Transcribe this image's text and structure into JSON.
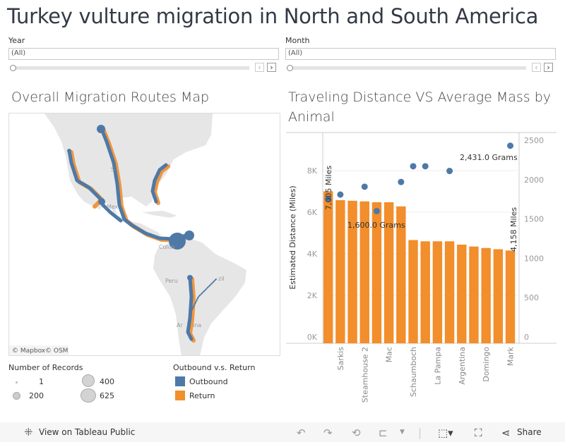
{
  "title": "Turkey vulture migration in North and South America",
  "filters": [
    {
      "label": "Year",
      "value": "(All)"
    },
    {
      "label": "Month",
      "value": "(All)"
    }
  ],
  "map": {
    "title": "Overall Migration Routes Map",
    "attribution": [
      "© Mapbox",
      "© OSM"
    ],
    "place_labels": [
      "S",
      "Mex",
      "Colon",
      "Peru",
      "Ar",
      "ina",
      "zil"
    ],
    "legend_size": {
      "title": "Number of Records",
      "items": [
        "1",
        "200",
        "400",
        "625"
      ]
    },
    "legend_color": {
      "title": "Outbound v.s. Return",
      "items": [
        {
          "label": "Outbound",
          "color": "#4e79a7"
        },
        {
          "label": "Return",
          "color": "#f28e2b"
        }
      ]
    }
  },
  "chart_data": {
    "type": "bar",
    "title": "Traveling Distance VS Average Mass by Animal",
    "ylabel": "Estimated Distance (Miles)",
    "ylim": [
      0,
      9500
    ],
    "y_ticks": [
      "0K",
      "2K",
      "4K",
      "6K",
      "8K"
    ],
    "y2lim": [
      0,
      2600
    ],
    "y2_ticks": [
      "0",
      "500",
      "1000",
      "1500",
      "2000",
      "2500"
    ],
    "categories": [
      "",
      "Sarkis",
      "",
      "Steamhouse 2",
      "",
      "Mac",
      "",
      "Schaumboch",
      "",
      "La Pampa",
      "",
      "Argentina",
      "",
      "Domingo",
      "",
      "Mark"
    ],
    "series": [
      {
        "values": [
          7005,
          6580,
          6550,
          6520,
          6480,
          6480,
          6280,
          4660,
          4600,
          4600,
          4600,
          4440,
          4350,
          4280,
          4220,
          4158
        ],
        "color": "#f28e2b",
        "mark": "bar"
      },
      {
        "values": [
          1760,
          1810,
          null,
          1910,
          1600,
          null,
          1970,
          2170,
          2170,
          null,
          2110,
          null,
          null,
          null,
          null,
          2431
        ],
        "color": "#4e79a7",
        "mark": "circle"
      }
    ],
    "annotations": [
      "7,005 Miles",
      "1,600.0 Grams",
      "2,431.0 Grams",
      "4,158 Miles"
    ],
    "grid": true
  },
  "toolbar": {
    "view_label": "View on Tableau Public",
    "share_label": "Share"
  }
}
